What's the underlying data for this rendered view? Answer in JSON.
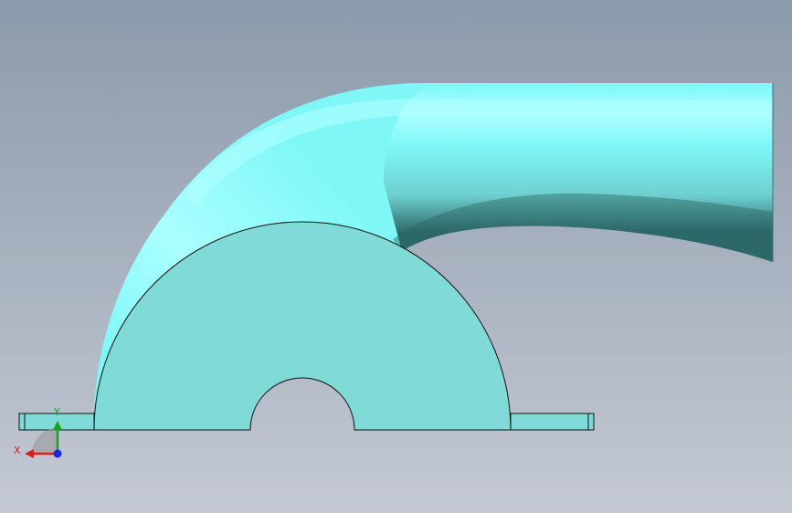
{
  "viewport": {
    "background_top": "#8b9aaa",
    "background_bottom": "#c4c9d4"
  },
  "model": {
    "face_color": "#80dad8",
    "tube_highlight": "#aaffff",
    "tube_light": "#7ff7f7",
    "tube_mid": "#6fcfcf",
    "tube_dark": "#2f6a6a",
    "edge_color": "#111111"
  },
  "triad": {
    "x_label": "X",
    "y_label": "Y",
    "x_color": "#d42020",
    "y_color": "#1aa01a",
    "z_color": "#1a2ad8"
  }
}
